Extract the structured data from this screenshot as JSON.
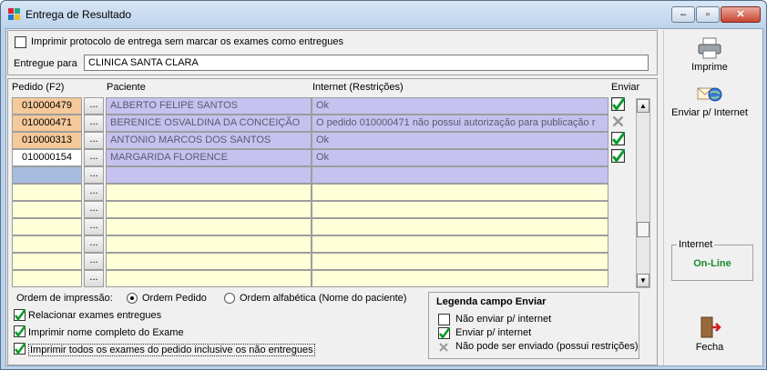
{
  "window": {
    "title": "Entrega de Resultado",
    "min": "‒",
    "max": "▫",
    "close": "✕"
  },
  "top": {
    "print_checkbox_label": "Imprimir protocolo de entrega sem marcar os exames como entregues",
    "entregue_label": "Entregue para",
    "entregue_value": "CLINICA SANTA CLARA"
  },
  "grid": {
    "headers": {
      "pedido": "Pedido (F2)",
      "paciente": "Paciente",
      "internet": "Internet (Restrições)",
      "enviar": "Enviar"
    },
    "rows": [
      {
        "pedido": "010000479",
        "paciente": "ALBERTO FELIPE SANTOS",
        "internet": "Ok",
        "enviar": "check"
      },
      {
        "pedido": "010000471",
        "paciente": "BERENICE OSVALDINA DA CONCEIÇÃO",
        "internet": "O pedido 010000471 não possui autorização para publicação r",
        "enviar": "x"
      },
      {
        "pedido": "010000313",
        "paciente": "ANTONIO MARCOS DOS SANTOS",
        "internet": "Ok",
        "enviar": "check"
      },
      {
        "pedido": "010000154",
        "paciente": "MARGARIDA FLORENCE",
        "internet": "Ok",
        "enviar": "check"
      }
    ],
    "ellipsis": "...",
    "colors": {
      "pedido_sel": "#f6c99a",
      "row_blue": "#c5c2ef",
      "row_yellow": "#ffffd8",
      "empty_blue": "#a7bde0"
    }
  },
  "ordem": {
    "label": "Ordem de impressão:",
    "opt1": "Ordem Pedido",
    "opt2": "Ordem alfabética (Nome do paciente)"
  },
  "options": {
    "relacionar": "Relacionar exames entregues",
    "nome_completo": "Imprimir nome completo do Exame",
    "todos": "Imprimir todos os exames do pedido inclusive os não entregues"
  },
  "legend": {
    "title": "Legenda campo Enviar",
    "nao_enviar": "Não enviar p/ internet",
    "enviar": "Enviar p/ internet",
    "nao_pode": "Não pode ser enviado (possui restrições)"
  },
  "side": {
    "imprime": "Imprime",
    "enviar": "Enviar p/ Internet",
    "internet_group": "Internet",
    "status": "On-Line",
    "fecha": "Fecha",
    "status_color": "#1c8a2a"
  }
}
